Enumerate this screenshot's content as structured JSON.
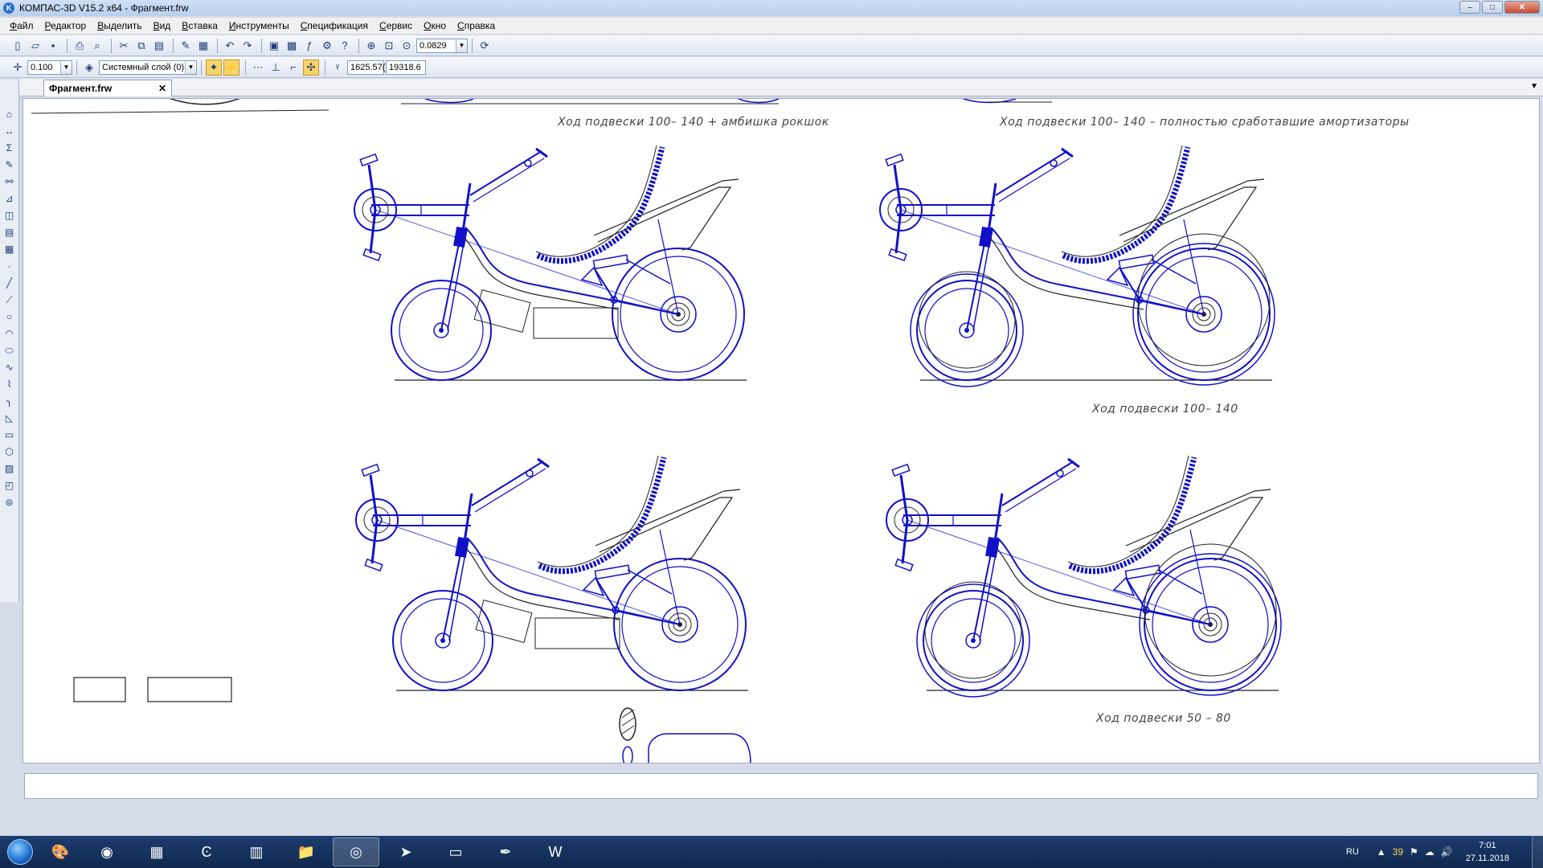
{
  "window": {
    "title": "КОМПАС-3D V15.2  x64 - Фрагмент.frw",
    "app_icon": "K",
    "minimize": "–",
    "maximize": "□",
    "close": "✕"
  },
  "menu": [
    "Файл",
    "Редактор",
    "Выделить",
    "Вид",
    "Вставка",
    "Инструменты",
    "Спецификация",
    "Сервис",
    "Окно",
    "Справка"
  ],
  "toolbar1": {
    "icons": [
      "new-icon",
      "open-icon",
      "save-icon",
      "print-icon",
      "preview-icon",
      "cut-icon",
      "copy-icon",
      "paste-icon",
      "properties-icon",
      "table-icon",
      "undo-icon",
      "redo-icon",
      "manager-icon",
      "library-icon",
      "variables-icon",
      "measure-icon",
      "help-icon",
      "zoom-window-icon",
      "zoom-fit-icon",
      "zoom-icon",
      "refresh-icon"
    ],
    "zoom_value": "0.0829"
  },
  "toolbar2": {
    "step_value": "0.100",
    "layer_value": "Системный слой (0)",
    "coord_x": "1625.57(",
    "coord_y": "19318.6"
  },
  "document_tab": {
    "label": "Фрагмент.frw",
    "close": "✕"
  },
  "captions": {
    "top_left": "Ход подвески 100– 140 + амбишка рокшок",
    "top_right": "Ход подвески 100– 140 – полностью сработавшие амортизаторы",
    "mid_right": "Ход подвески 100– 140",
    "bottom_right": "Ход подвески 50 – 80"
  },
  "taskbar": {
    "apps": [
      "paint-icon",
      "chrome-icon",
      "calculator-icon",
      "ccleaner-icon",
      "winrar-icon",
      "explorer-icon",
      "kompas-icon",
      "telegram-icon",
      "remote-icon",
      "acrobat-icon",
      "word-icon"
    ],
    "active_index": 6,
    "lang": "RU",
    "notify_count": "39",
    "time": "7:01",
    "date": "27.11.2018"
  },
  "colors": {
    "drawing_blue": "#1010c8",
    "drawing_black": "#222222",
    "taskbar": "#163563"
  }
}
